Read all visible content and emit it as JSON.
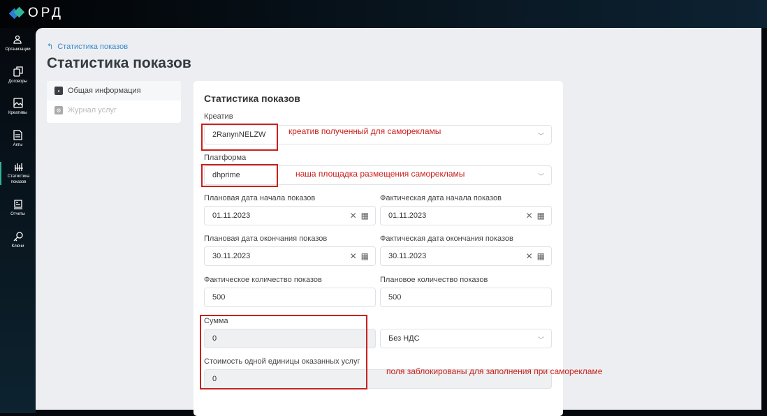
{
  "app": {
    "logo": "ОРД"
  },
  "sidebar": {
    "items": [
      {
        "label": "Организации"
      },
      {
        "label": "Договоры"
      },
      {
        "label": "Креативы"
      },
      {
        "label": "Акты"
      },
      {
        "label": "Статистика показов"
      },
      {
        "label": "Отчеты"
      },
      {
        "label": "Ключи"
      }
    ]
  },
  "breadcrumb": "Статистика показов",
  "page_title": "Статистика показов",
  "tabs": [
    {
      "label": "Общая информация"
    },
    {
      "label": "Журнал услуг"
    }
  ],
  "form": {
    "title": "Статистика показов",
    "creative": {
      "label": "Креатив",
      "value": "2RanynNELZW"
    },
    "platform": {
      "label": "Платформа",
      "value": "dhprime"
    },
    "plan_start": {
      "label": "Плановая дата начала показов",
      "value": "01.11.2023"
    },
    "fact_start": {
      "label": "Фактическая дата начала показов",
      "value": "01.11.2023"
    },
    "plan_end": {
      "label": "Плановая дата окончания показов",
      "value": "30.11.2023"
    },
    "fact_end": {
      "label": "Фактическая дата окончания показов",
      "value": "30.11.2023"
    },
    "fact_count": {
      "label": "Фактическое количество показов",
      "value": "500"
    },
    "plan_count": {
      "label": "Плановое количество показов",
      "value": "500"
    },
    "sum": {
      "label": "Сумма",
      "value": "0"
    },
    "vat": {
      "value": "Без НДС"
    },
    "unit_cost": {
      "label": "Стоимость одной единицы оказанных услуг",
      "value": "0"
    }
  },
  "annotations": {
    "creative": "креатив полученный для саморекламы",
    "platform": "наша площадка размещения саморекламы",
    "locked": "поля заблокированы для заполнения при саморекламе"
  },
  "colors": {
    "accent": "#3a8ac8",
    "annotation": "#c8211d"
  }
}
